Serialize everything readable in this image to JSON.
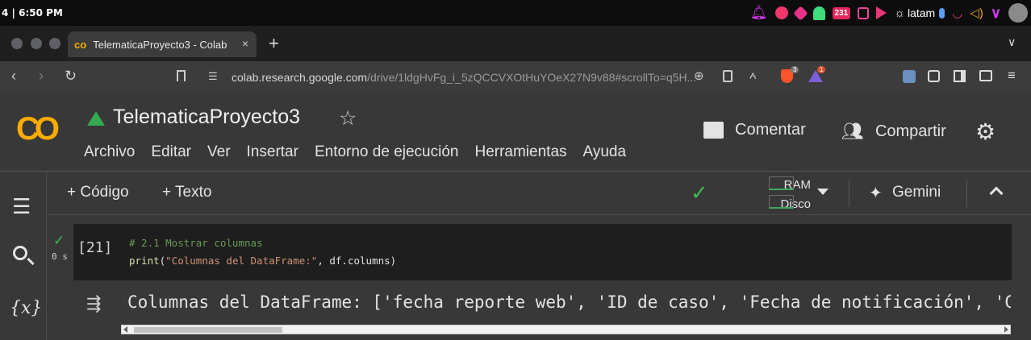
{
  "system": {
    "time": "4 | 6:50 PM",
    "wifi_label": "latam",
    "badge_count": "231"
  },
  "browser": {
    "tab_title": "TelematicaProyecto3 - Colab",
    "tab_close": "×",
    "new_tab": "+",
    "url_host": "colab.research.google.com",
    "url_path": "/drive/1ldgHvFg_i_5zQCCVXOtHuYOeX27N9v88#scrollTo=q5H...",
    "brave_badge": "3",
    "rewards_badge": "1"
  },
  "colab": {
    "logo_text": "CO",
    "notebook_title": "TelematicaProyecto3",
    "menu": [
      "Archivo",
      "Editar",
      "Ver",
      "Insertar",
      "Entorno de ejecución",
      "Herramientas",
      "Ayuda"
    ],
    "comment_label": "Comentar",
    "share_label": "Compartir"
  },
  "toolbar": {
    "add_code": "+ Código",
    "add_text": "+ Texto",
    "ram_label": "RAM",
    "disk_label": "Disco",
    "gemini_label": "Gemini"
  },
  "sidebar": {
    "vars_label": "{x}"
  },
  "cell": {
    "exec_count": "[21]",
    "exec_time": "0 s",
    "code_comment": "# 2.1 Mostrar columnas",
    "code_fn": "print",
    "code_open": "(",
    "code_string": "\"Columnas del DataFrame:\"",
    "code_rest": ", df.columns)",
    "output": "Columnas del DataFrame: ['fecha reporte web', 'ID de caso', 'Fecha de notificación', 'C"
  },
  "colors": {
    "accent_orange": "#f9ab00",
    "ok_green": "#3fb950",
    "comment_green": "#6a9955",
    "string_orange": "#ce9178"
  }
}
